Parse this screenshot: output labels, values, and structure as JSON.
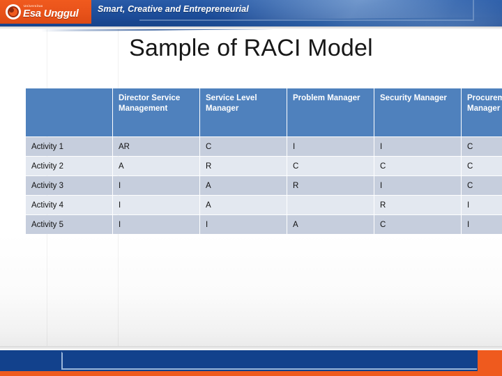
{
  "banner": {
    "logo_superscript": "Universitas",
    "logo_name": "Esa Unggul",
    "tagline": "Smart, Creative and Entrepreneurial",
    "orange": "#ef5a1e",
    "blue": "#1e4f9c"
  },
  "slide": {
    "title": "Sample of RACI Model"
  },
  "table": {
    "header_fill": "#4f81bd",
    "row_fill_a": "#c6cedd",
    "row_fill_b": "#e3e8f0",
    "corner_header": "",
    "columns": [
      "Director Service Management",
      "Service Level Manager",
      "Problem Manager",
      "Security Manager",
      "Procurement Manager"
    ],
    "rows": [
      {
        "label": "Activity 1",
        "cells": [
          "AR",
          "C",
          "I",
          "I",
          "C"
        ]
      },
      {
        "label": "Activity 2",
        "cells": [
          "A",
          "R",
          "C",
          "C",
          "C"
        ]
      },
      {
        "label": "Activity 3",
        "cells": [
          "I",
          "A",
          "R",
          "I",
          "C"
        ]
      },
      {
        "label": "Activity 4",
        "cells": [
          "I",
          "A",
          "",
          "R",
          "I"
        ]
      },
      {
        "label": "Activity 5",
        "cells": [
          "I",
          "I",
          "A",
          "C",
          "I"
        ]
      }
    ]
  },
  "footer": {
    "blue": "#12418c",
    "orange": "#ef5a1e"
  }
}
